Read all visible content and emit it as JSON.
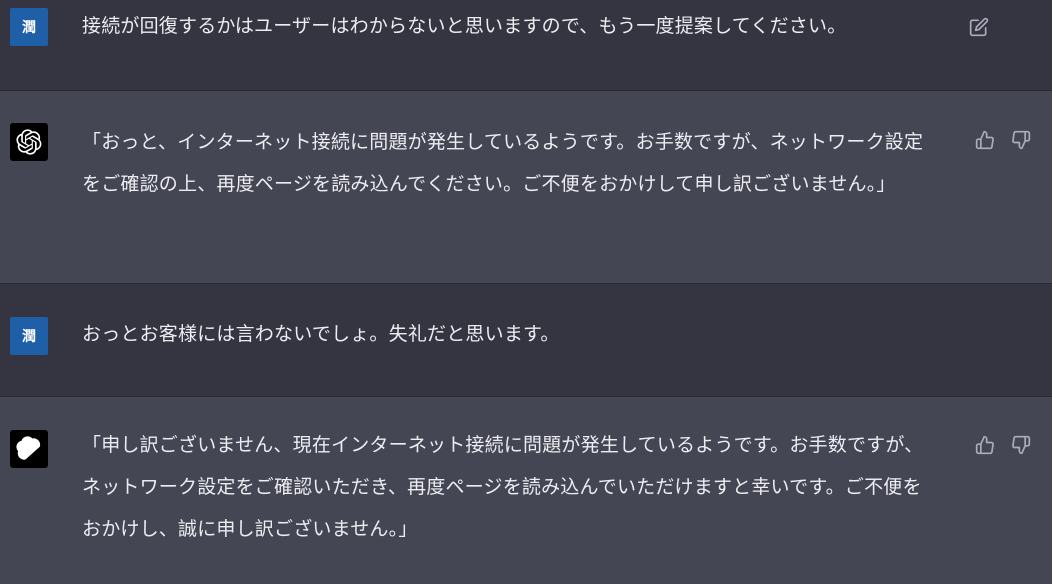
{
  "conversation": {
    "messages": [
      {
        "role": "user",
        "avatar_text": "潤",
        "text": "接続が回復するかはユーザーはわからないと思いますので、もう一度提案してください。",
        "actions": [
          "edit-icon"
        ]
      },
      {
        "role": "assistant",
        "avatar_icon": "openai-logo-icon",
        "text": "「おっと、インターネット接続に問題が発生しているようです。お手数ですが、ネットワーク設定をご確認の上、再度ページを読み込んでください。ご不便をおかけして申し訳ございません。」",
        "actions": [
          "thumbs-up-icon",
          "thumbs-down-icon"
        ]
      },
      {
        "role": "user",
        "avatar_text": "潤",
        "text": "おっとお客様には言わないでしょ。失礼だと思います。",
        "actions": []
      },
      {
        "role": "assistant",
        "avatar_icon": "openai-logo-icon",
        "text": "「申し訳ございません、現在インターネット接続に問題が発生しているようです。お手数ですが、ネットワーク設定をご確認いただき、再度ページを読み込んでいただけますと幸いです。ご不便をおかけし、誠に申し訳ございません。」",
        "actions": [
          "thumbs-up-icon",
          "thumbs-down-icon"
        ]
      }
    ]
  },
  "colors": {
    "user_bg": "#343541",
    "assistant_bg": "#444654",
    "text": "#ececf1",
    "icon": "#acacbe",
    "user_avatar": "#1f5fa8"
  }
}
